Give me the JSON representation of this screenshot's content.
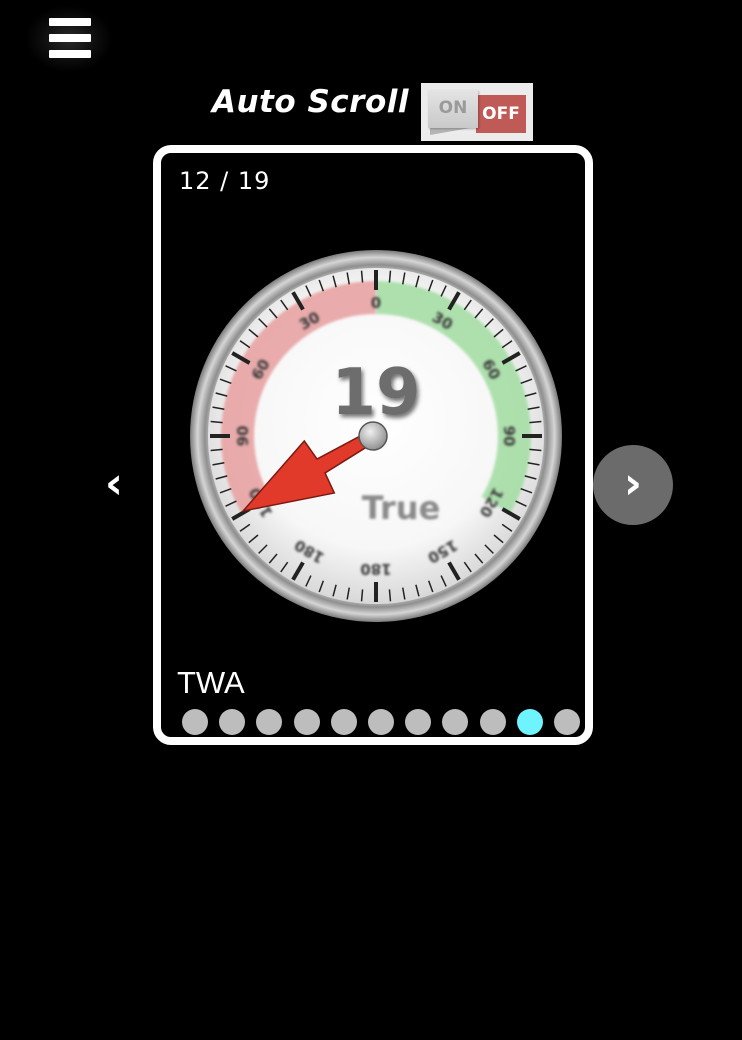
{
  "menu": {
    "icon": "hamburger-menu-icon"
  },
  "autoscroll": {
    "label": "Auto Scroll",
    "toggle_on": "ON",
    "toggle_off": "OFF",
    "state": "off"
  },
  "carousel": {
    "counter": "12 / 19",
    "caption": "TWA",
    "active_dot": 9,
    "dot_count": 11,
    "prev_icon": "‹",
    "next_icon": "›"
  },
  "gauge": {
    "value": "19",
    "label": "True",
    "needle_angle": -60,
    "scale_labels": [
      {
        "text": "0",
        "angle": 0
      },
      {
        "text": "30",
        "angle": 30
      },
      {
        "text": "60",
        "angle": 60
      },
      {
        "text": "90",
        "angle": 90
      },
      {
        "text": "120",
        "angle": 120
      },
      {
        "text": "150",
        "angle": 150
      },
      {
        "text": "180",
        "angle": 180
      },
      {
        "text": "180",
        "angle": 210
      },
      {
        "text": "120",
        "angle": 240
      },
      {
        "text": "90",
        "angle": 270
      },
      {
        "text": "60",
        "angle": 300
      },
      {
        "text": "30",
        "angle": 330
      }
    ],
    "colors": {
      "port": "#e8a3a3",
      "starboard": "#a6dea6",
      "needle": "#e23a2a",
      "highlight": "#6ef4ff"
    }
  }
}
